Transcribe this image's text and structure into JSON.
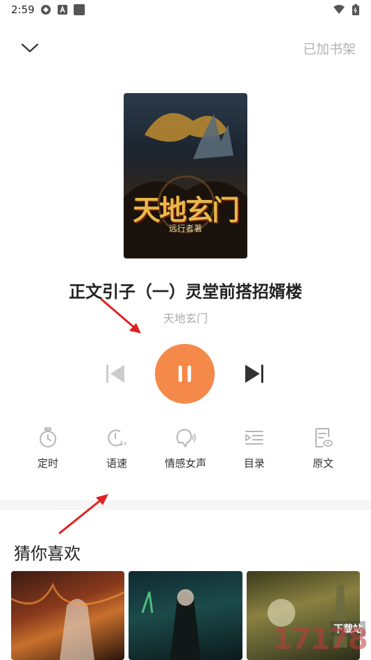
{
  "status": {
    "time": "2:59"
  },
  "topbar": {
    "shelf_label": "已加书架"
  },
  "book": {
    "chapter_title": "正文引子（一）灵堂前搭招婿楼",
    "name": "天地玄门",
    "cover_title": "天地玄门",
    "cover_author": "远行者著"
  },
  "tools": [
    {
      "label": "定时",
      "icon": "timer-icon"
    },
    {
      "label": "语速",
      "icon": "speed-icon"
    },
    {
      "label": "情感女声",
      "icon": "voice-icon"
    },
    {
      "label": "目录",
      "icon": "catalog-icon"
    },
    {
      "label": "原文",
      "icon": "original-text-icon"
    }
  ],
  "recommend": {
    "title": "猜你喜欢"
  },
  "watermark": {
    "text": "17178",
    "site": "下载站"
  },
  "colors": {
    "accent": "#f5894a",
    "arrow": "#e02020"
  }
}
